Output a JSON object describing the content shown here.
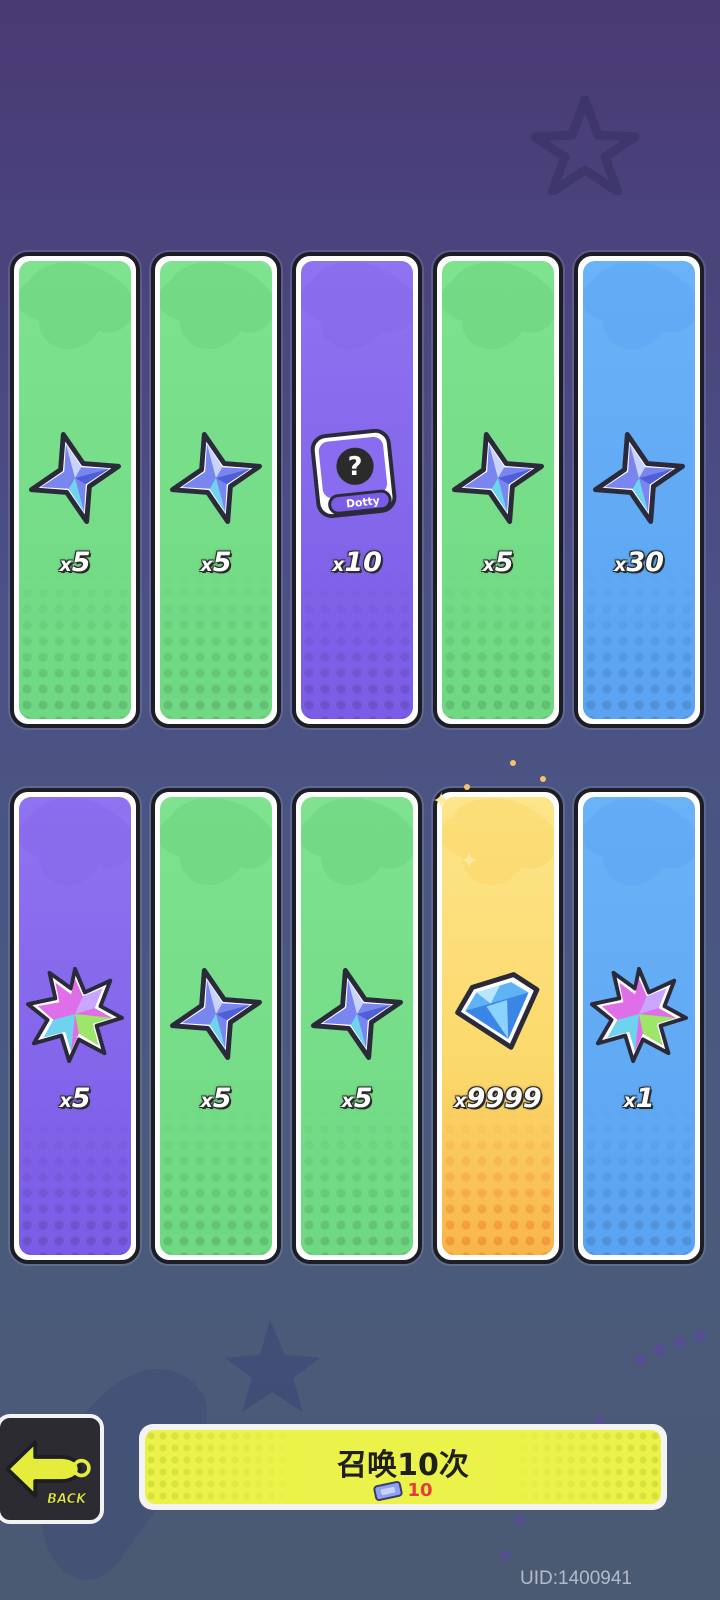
{
  "row1": [
    {
      "rarity": "green",
      "item": "star-shard-icon",
      "qty_prefix": "x",
      "qty": "5"
    },
    {
      "rarity": "green",
      "item": "star-shard-icon",
      "qty_prefix": "x",
      "qty": "5"
    },
    {
      "rarity": "purple",
      "item": "mystery-dotty-icon",
      "qty_prefix": "x",
      "qty": "10"
    },
    {
      "rarity": "green",
      "item": "star-shard-icon",
      "qty_prefix": "x",
      "qty": "5"
    },
    {
      "rarity": "blue",
      "item": "star-shard-icon",
      "qty_prefix": "x",
      "qty": "30"
    }
  ],
  "row2": [
    {
      "rarity": "purple",
      "item": "rainbow-leaf-icon",
      "qty_prefix": "x",
      "qty": "5"
    },
    {
      "rarity": "green",
      "item": "star-shard-icon",
      "qty_prefix": "x",
      "qty": "5"
    },
    {
      "rarity": "green",
      "item": "star-shard-icon",
      "qty_prefix": "x",
      "qty": "5"
    },
    {
      "rarity": "gold",
      "item": "diamond-gem-icon",
      "qty_prefix": "x",
      "qty": "9999"
    },
    {
      "rarity": "blue",
      "item": "rainbow-leaf-icon",
      "qty_prefix": "x",
      "qty": "1"
    }
  ],
  "mystery_badge_text": "Dotty",
  "back_label": "BACK",
  "summon": {
    "label": "召唤10次",
    "cost": "10"
  },
  "uid": "UID:1400941",
  "colors": {
    "green": "#7ee28e",
    "purple": "#8f73f0",
    "blue": "#6ab3f7",
    "gold": "#fde58a",
    "summon_bg": "#ebf249",
    "cost_text": "#e53b3b"
  }
}
